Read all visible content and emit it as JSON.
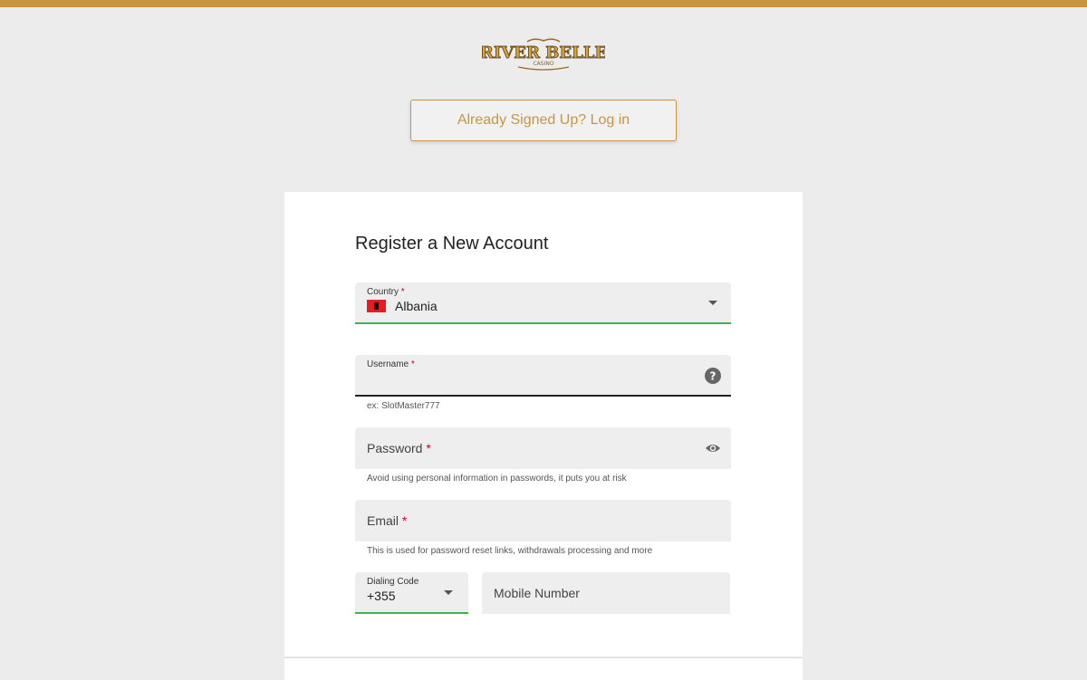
{
  "colors": {
    "accent": "#c9963f",
    "background": "#ececec",
    "field_bg": "#eeeeee",
    "valid_underline": "#3db34f",
    "required": "#d0021b"
  },
  "brand": {
    "logo_text": "RIVER BELLE",
    "logo_subtext": "CASINO"
  },
  "login": {
    "label": "Already Signed Up? Log in"
  },
  "form": {
    "title": "Register a New Account",
    "country": {
      "label": "Country",
      "required_mark": "*",
      "value": "Albania",
      "flag_icon": "albania-flag-icon",
      "dropdown_icon": "caret-down-icon"
    },
    "username": {
      "label": "Username",
      "required_mark": "*",
      "value": "",
      "helper": "ex: SlotMaster777",
      "help_icon": "question-circle-icon"
    },
    "password": {
      "placeholder": "Password",
      "required_mark": "*",
      "helper": "Avoid using personal information in passwords, it puts you at risk",
      "toggle_icon": "eye-icon"
    },
    "email": {
      "placeholder": "Email",
      "required_mark": "*",
      "helper": "This is used for password reset links, withdrawals processing and more"
    },
    "dialing_code": {
      "label": "Dialing Code",
      "value": "+355",
      "dropdown_icon": "caret-down-icon"
    },
    "mobile": {
      "placeholder": "Mobile Number"
    }
  }
}
